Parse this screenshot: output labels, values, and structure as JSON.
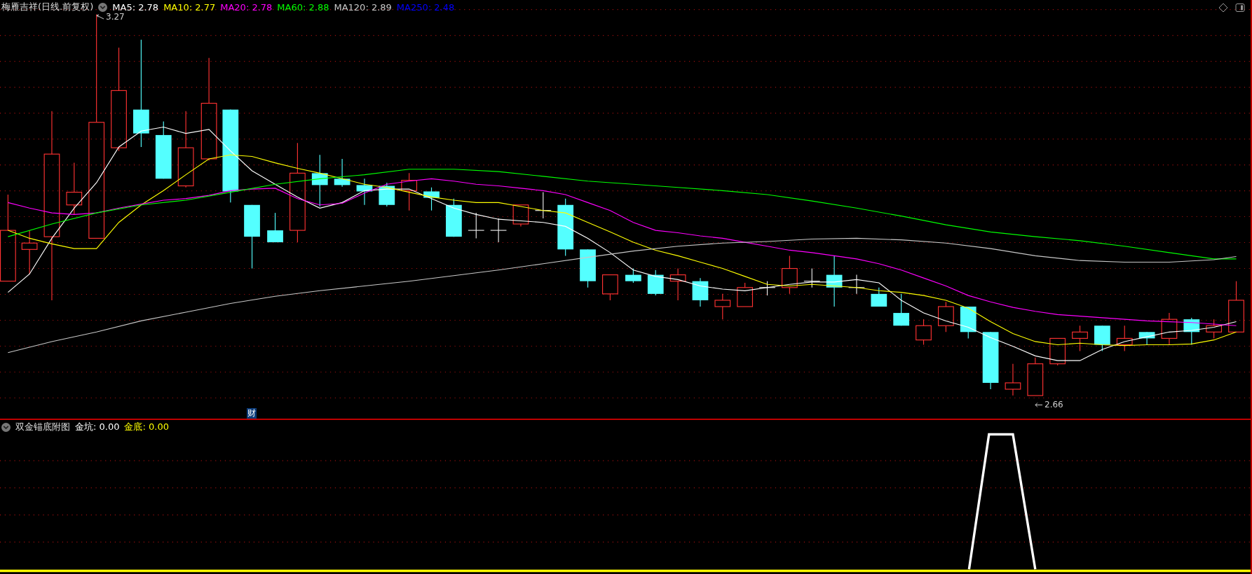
{
  "title": "梅雁吉祥(日线.前复权)",
  "moving_averages": [
    {
      "text": "MA5: 2.78",
      "color": "#ffffff"
    },
    {
      "text": "MA10: 2.77",
      "color": "#ffff00"
    },
    {
      "text": "MA20: 2.78",
      "color": "#ff00ff"
    },
    {
      "text": "MA60: 2.88",
      "color": "#00ff00"
    },
    {
      "text": "MA120: 2.89",
      "color": "#c8c8c8"
    },
    {
      "text": "MA250: 2.48",
      "color": "#0000ff"
    }
  ],
  "high_mark": "3.27",
  "low_mark": "2.66",
  "event_marker": "财",
  "indicator": {
    "title": "双金锚底附图",
    "values": [
      {
        "text": "金坑: 0.00",
        "color": "#ffffff"
      },
      {
        "text": "金底: 0.00",
        "color": "#ffff00"
      }
    ]
  }
}
